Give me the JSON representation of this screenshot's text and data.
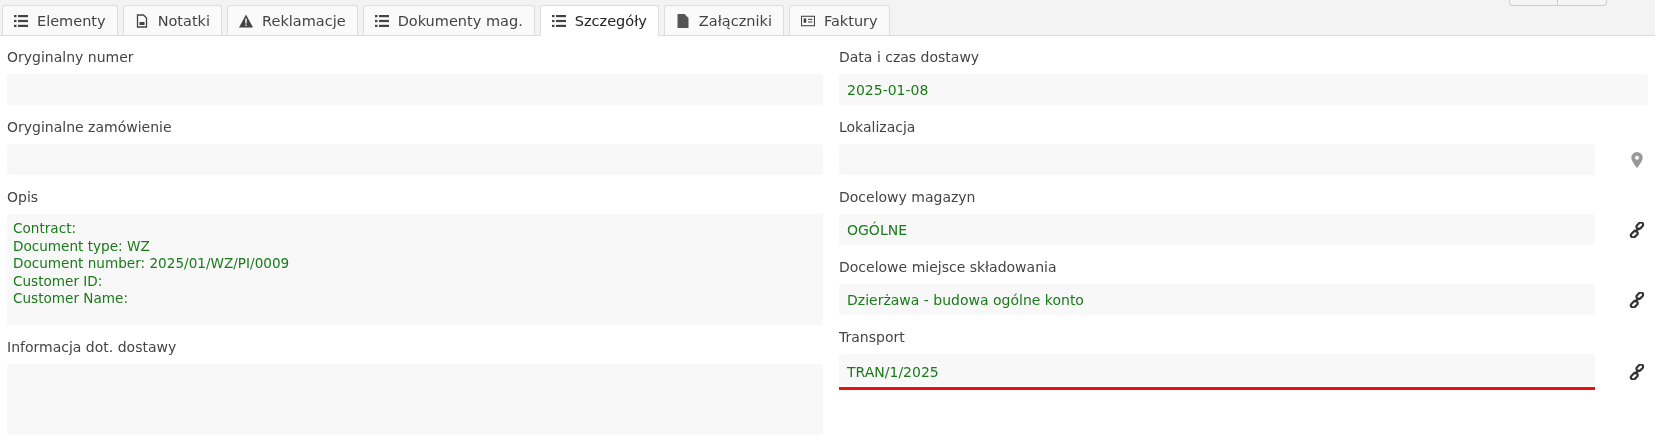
{
  "tabs": [
    {
      "label": "Elementy",
      "kind": "list",
      "selected": false
    },
    {
      "label": "Notatki",
      "kind": "note",
      "selected": false
    },
    {
      "label": "Reklamacje",
      "kind": "warning",
      "selected": false
    },
    {
      "label": "Dokumenty mag.",
      "kind": "list",
      "selected": false
    },
    {
      "label": "Szczegóły",
      "kind": "list",
      "selected": true
    },
    {
      "label": "Załączniki",
      "kind": "file",
      "selected": false
    },
    {
      "label": "Faktury",
      "kind": "card",
      "selected": false
    }
  ],
  "left_fields": [
    {
      "label": "Oryginalny numer",
      "kind": "input"
    },
    {
      "label": "Oryginalne zamówienie",
      "kind": "input"
    },
    {
      "label": "Opis",
      "kind": "textarea",
      "lines": [
        "Contract:",
        "Document type: WZ",
        "Document number: 2025/01/WZ/PI/0009",
        "Customer ID:",
        "Customer Name:"
      ]
    },
    {
      "label": "Informacja dot. dostawy",
      "kind": "textarea"
    }
  ],
  "right_fields": [
    {
      "label": "Data i czas dostawy",
      "value": "2025-01-08",
      "kind": "plain",
      "highlighted": false
    },
    {
      "label": "Lokalizacja",
      "kind": "location",
      "highlighted": false
    },
    {
      "label": "Docelowy magazyn",
      "value": "OGÓLNE",
      "kind": "link",
      "highlighted": false
    },
    {
      "label": "Docelowe miejsce składowania",
      "value": "Dzierżawa - budowa ogólne konto",
      "kind": "link",
      "highlighted": false
    },
    {
      "label": "Transport",
      "value": "TRAN/1/2025",
      "kind": "link",
      "highlighted": true
    }
  ]
}
